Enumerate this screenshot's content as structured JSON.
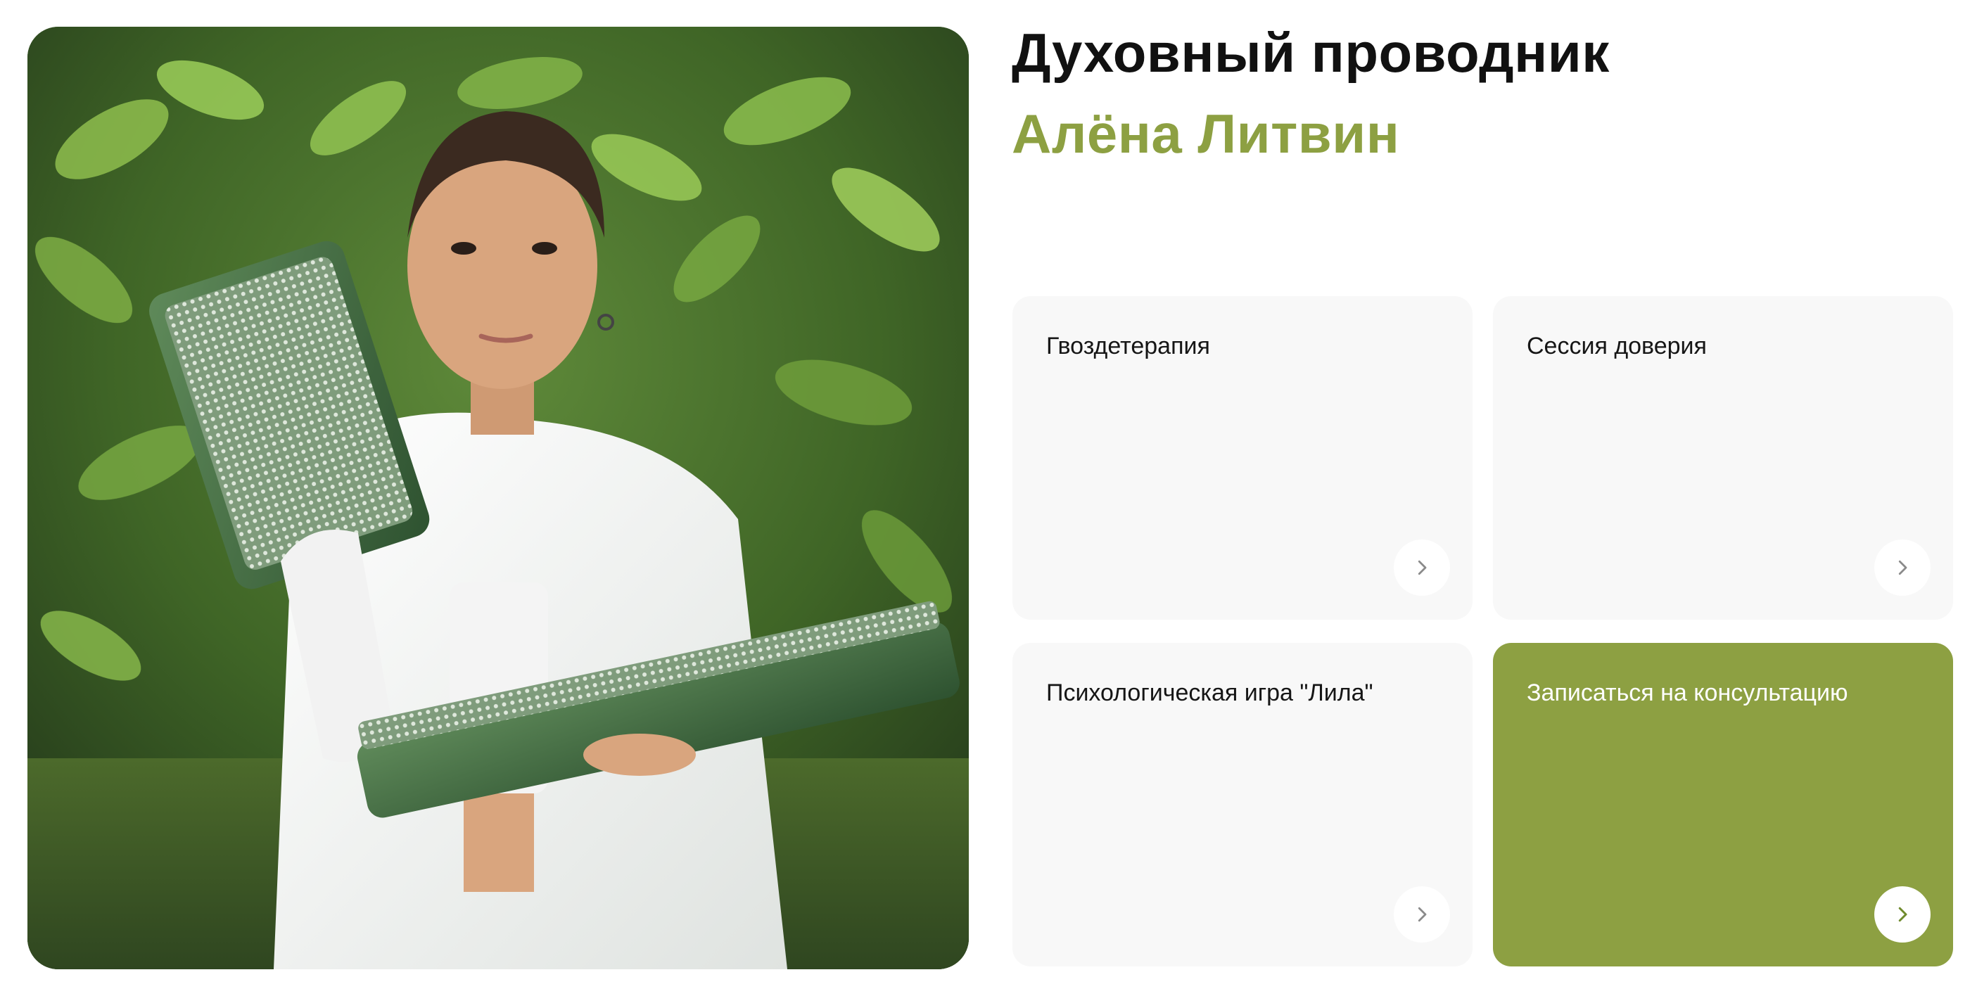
{
  "header": {
    "title": "Духовный проводник",
    "name": "Алёна Литвин"
  },
  "photo": {
    "icon": "portrait-photo"
  },
  "cards": [
    {
      "label": "Гвоздетерапия",
      "icon": "chevron-right-icon"
    },
    {
      "label": "Сессия доверия",
      "icon": "chevron-right-icon"
    },
    {
      "label": "Психологическая игра \"Лила\"",
      "icon": "chevron-right-icon"
    },
    {
      "label": "Записаться на консультацию",
      "icon": "chevron-right-icon"
    }
  ],
  "colors": {
    "accent": "#8da042",
    "card_bg": "#f8f8f8",
    "title": "#111111",
    "arrow_default": "#8a8a8a",
    "arrow_accent": "#6f8a2c"
  }
}
